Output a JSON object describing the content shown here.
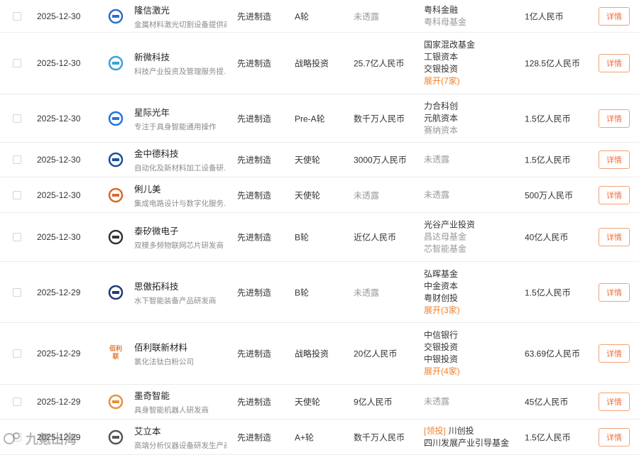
{
  "rows": [
    {
      "date": "2025-12-30",
      "company": "隆信激光",
      "desc": "金属材料激光切割设备提供商",
      "industry": "先进制造",
      "round": "A轮",
      "amount": "未透露",
      "amount_muted": true,
      "investors": [
        {
          "text": "粤科金融",
          "style": "strong"
        },
        {
          "text": "粤科母基金",
          "style": "muted"
        }
      ],
      "valuation": "1亿人民币",
      "detail": "详情",
      "logo_color": "#2b6fc7"
    },
    {
      "date": "2025-12-30",
      "company": "新微科技",
      "desc": "科技产业投资及管理服务提...",
      "industry": "先进制造",
      "round": "战略投资",
      "amount": "25.7亿人民币",
      "amount_muted": false,
      "investors": [
        {
          "text": "国家混改基金",
          "style": "strong"
        },
        {
          "text": "工银资本",
          "style": "strong"
        },
        {
          "text": "交银投资",
          "style": "strong"
        },
        {
          "text": "展开(7家)",
          "style": "expand"
        }
      ],
      "valuation": "128.5亿人民币",
      "detail": "详情",
      "logo_color": "#3aa0d8"
    },
    {
      "date": "2025-12-30",
      "company": "星际光年",
      "desc": "专注于具身智能通用操作",
      "industry": "先进制造",
      "round": "Pre-A轮",
      "amount": "数千万人民币",
      "amount_muted": false,
      "investors": [
        {
          "text": "力合科创",
          "style": "strong"
        },
        {
          "text": "元航资本",
          "style": "strong"
        },
        {
          "text": "赛纳资本",
          "style": "muted"
        }
      ],
      "valuation": "1.5亿人民币",
      "detail": "详情",
      "logo_color": "#1e78d6"
    },
    {
      "date": "2025-12-30",
      "company": "金中德科技",
      "desc": "自动化及新材料加工设备研...",
      "industry": "先进制造",
      "round": "天使轮",
      "amount": "3000万人民币",
      "amount_muted": false,
      "investors": [
        {
          "text": "未透露",
          "style": "muted"
        }
      ],
      "valuation": "1.5亿人民币",
      "detail": "详情",
      "logo_color": "#1a4f9c"
    },
    {
      "date": "2025-12-30",
      "company": "俐儿美",
      "desc": "集成电路设计与数字化服务...",
      "industry": "先进制造",
      "round": "天使轮",
      "amount": "未透露",
      "amount_muted": true,
      "investors": [
        {
          "text": "未透露",
          "style": "muted"
        }
      ],
      "valuation": "500万人民币",
      "detail": "详情",
      "logo_color": "#d86a2a"
    },
    {
      "date": "2025-12-30",
      "company": "泰矽微电子",
      "desc": "双模多频物联网芯片研发商",
      "industry": "先进制造",
      "round": "B轮",
      "amount": "近亿人民币",
      "amount_muted": false,
      "investors": [
        {
          "text": "光谷产业投资",
          "style": "strong"
        },
        {
          "text": "昌达母基金",
          "style": "muted"
        },
        {
          "text": "芯智能基金",
          "style": "muted"
        }
      ],
      "valuation": "40亿人民币",
      "detail": "详情",
      "logo_color": "#333333"
    },
    {
      "date": "2025-12-29",
      "company": "思傲拓科技",
      "desc": "水下智能装备产品研发商",
      "industry": "先进制造",
      "round": "B轮",
      "amount": "未透露",
      "amount_muted": true,
      "investors": [
        {
          "text": "弘晖基金",
          "style": "strong"
        },
        {
          "text": "中金资本",
          "style": "strong"
        },
        {
          "text": "粤财创投",
          "style": "strong"
        },
        {
          "text": "展开(3家)",
          "style": "expand"
        }
      ],
      "valuation": "1.5亿人民币",
      "detail": "详情",
      "logo_color": "#1f3b73"
    },
    {
      "date": "2025-12-29",
      "company": "佰利联新材料",
      "desc": "氯化法钛白粉公司",
      "industry": "先进制造",
      "round": "战略投资",
      "amount": "20亿人民币",
      "amount_muted": false,
      "investors": [
        {
          "text": "中信银行",
          "style": "strong"
        },
        {
          "text": "交银投资",
          "style": "strong"
        },
        {
          "text": "中银投资",
          "style": "strong"
        },
        {
          "text": "展开(4家)",
          "style": "expand"
        }
      ],
      "valuation": "63.69亿人民币",
      "detail": "详情",
      "logo_color": "#e07a2f",
      "logo_text": "佰利联"
    },
    {
      "date": "2025-12-29",
      "company": "墨奇智能",
      "desc": "具身智能机器人研发商",
      "industry": "先进制造",
      "round": "天使轮",
      "amount": "9亿人民币",
      "amount_muted": false,
      "investors": [
        {
          "text": "未透露",
          "style": "muted"
        }
      ],
      "valuation": "45亿人民币",
      "detail": "详情",
      "logo_color": "#e8923a"
    },
    {
      "date": "2025-12-29",
      "company": "艾立本",
      "desc": "高端分析仪器设备研发生产商",
      "industry": "先进制造",
      "round": "A+轮",
      "amount": "数千万人民币",
      "amount_muted": false,
      "investors": [
        {
          "lead": "[领投]",
          "text": "川创投",
          "style": "strong"
        },
        {
          "text": "四川发展产业引导基金",
          "style": "strong"
        }
      ],
      "valuation": "1.5亿人民币",
      "detail": "详情",
      "logo_color": "#555555"
    }
  ],
  "watermark": "九氪出海"
}
